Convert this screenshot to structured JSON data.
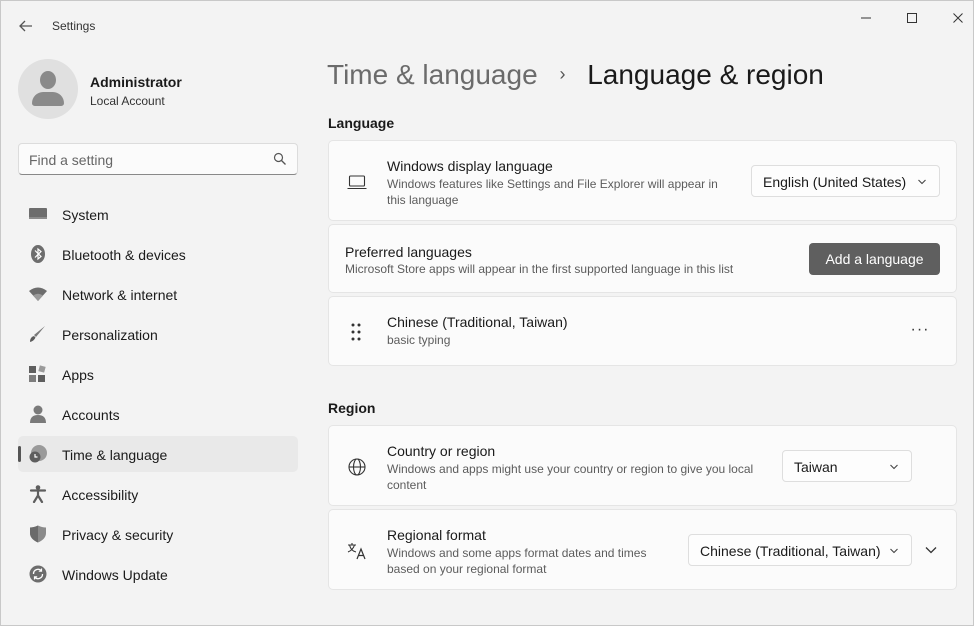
{
  "window": {
    "title": "Settings"
  },
  "profile": {
    "name": "Administrator",
    "account_type": "Local Account"
  },
  "search": {
    "placeholder": "Find a setting"
  },
  "sidebar": {
    "items": [
      {
        "label": "System",
        "icon": "system-icon",
        "active": false
      },
      {
        "label": "Bluetooth & devices",
        "icon": "bluetooth-icon",
        "active": false
      },
      {
        "label": "Network & internet",
        "icon": "wifi-icon",
        "active": false
      },
      {
        "label": "Personalization",
        "icon": "brush-icon",
        "active": false
      },
      {
        "label": "Apps",
        "icon": "apps-icon",
        "active": false
      },
      {
        "label": "Accounts",
        "icon": "accounts-icon",
        "active": false
      },
      {
        "label": "Time & language",
        "icon": "time-language-icon",
        "active": true
      },
      {
        "label": "Accessibility",
        "icon": "accessibility-icon",
        "active": false
      },
      {
        "label": "Privacy & security",
        "icon": "shield-icon",
        "active": false
      },
      {
        "label": "Windows Update",
        "icon": "update-icon",
        "active": false
      }
    ]
  },
  "breadcrumb": {
    "parent": "Time & language",
    "separator": "›",
    "current": "Language & region"
  },
  "language_section": {
    "title": "Language",
    "display_language": {
      "title": "Windows display language",
      "description": "Windows features like Settings and File Explorer will appear in this language",
      "value": "English (United States)"
    },
    "preferred_languages": {
      "title": "Preferred languages",
      "description": "Microsoft Store apps will appear in the first supported language in this list",
      "button": "Add a language"
    },
    "languages": [
      {
        "name": "Chinese (Traditional, Taiwan)",
        "detail": "basic typing",
        "more": "···"
      }
    ]
  },
  "region_section": {
    "title": "Region",
    "country": {
      "title": "Country or region",
      "description": "Windows and apps might use your country or region to give you local content",
      "value": "Taiwan"
    },
    "format": {
      "title": "Regional format",
      "description": "Windows and some apps format dates and times based on your regional format",
      "value": "Chinese (Traditional, Taiwan)"
    }
  },
  "colors": {
    "accent_button": "#5f5f5f",
    "active_indicator": "#555555",
    "background": "#f3f3f3"
  }
}
